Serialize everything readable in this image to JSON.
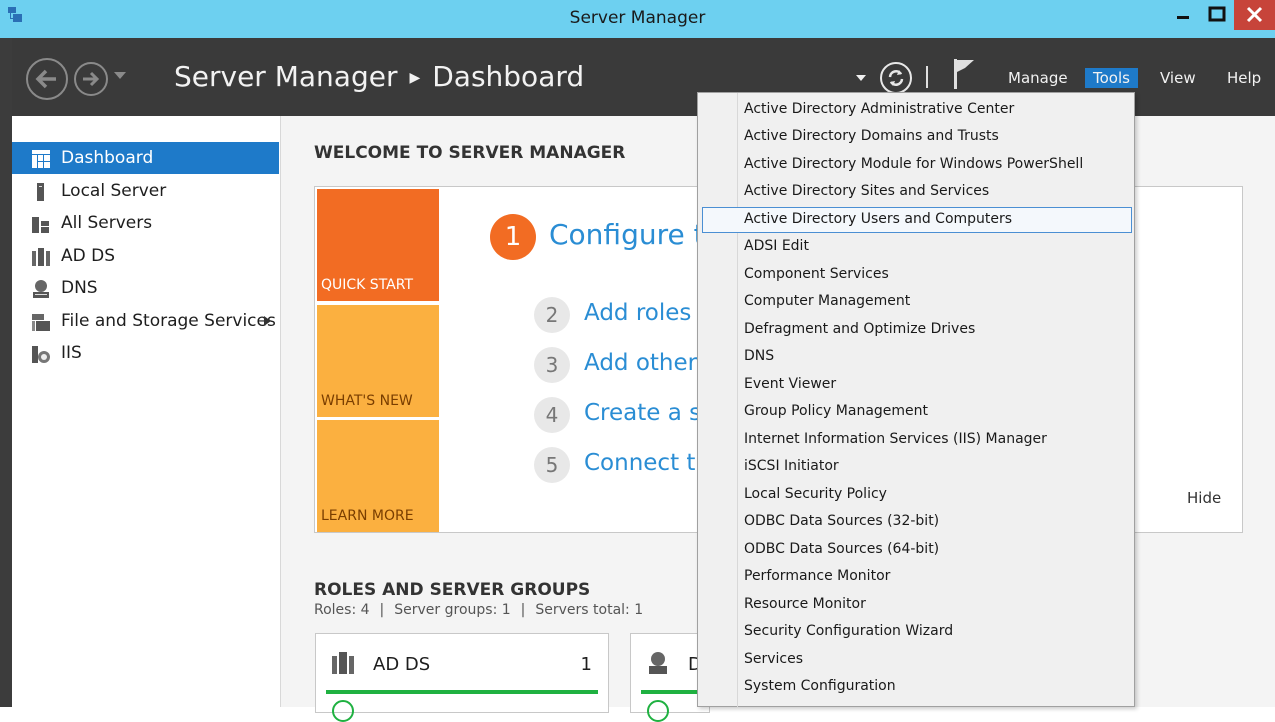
{
  "window": {
    "title": "Server Manager"
  },
  "header": {
    "breadcrumb_root": "Server Manager",
    "breadcrumb_page": "Dashboard",
    "menus": [
      "Manage",
      "Tools",
      "View",
      "Help"
    ],
    "active_menu": "Tools"
  },
  "sidebar": {
    "items": [
      {
        "label": "Dashboard",
        "icon": "dashboard-icon",
        "selected": true
      },
      {
        "label": "Local Server",
        "icon": "server-icon"
      },
      {
        "label": "All Servers",
        "icon": "servers-icon"
      },
      {
        "label": "AD DS",
        "icon": "ad-ds-icon"
      },
      {
        "label": "DNS",
        "icon": "dns-icon"
      },
      {
        "label": "File and Storage Services",
        "icon": "storage-icon",
        "has_submenu": true
      },
      {
        "label": "IIS",
        "icon": "iis-icon"
      }
    ]
  },
  "welcome": {
    "title": "WELCOME TO SERVER MANAGER",
    "tiles": [
      "QUICK START",
      "WHAT'S NEW",
      "LEARN MORE"
    ],
    "steps": [
      {
        "num": "1",
        "text": "Configure th"
      },
      {
        "num": "2",
        "text": "Add roles ar"
      },
      {
        "num": "3",
        "text": "Add other s"
      },
      {
        "num": "4",
        "text": "Create a ser"
      },
      {
        "num": "5",
        "text": "Connect thi"
      }
    ],
    "hide": "Hide"
  },
  "roles": {
    "title": "ROLES AND SERVER GROUPS",
    "roles_count": "Roles: 4",
    "groups_count": "Server groups: 1",
    "servers_total": "Servers total: 1",
    "cards": [
      {
        "name": "AD DS",
        "count": "1",
        "icon": "ad-ds-icon"
      },
      {
        "name": "D",
        "count": "",
        "icon": "dns-icon"
      }
    ]
  },
  "tools_menu": {
    "highlighted": "Active Directory Users and Computers",
    "items": [
      "Active Directory Administrative Center",
      "Active Directory Domains and Trusts",
      "Active Directory Module for Windows PowerShell",
      "Active Directory Sites and Services",
      "Active Directory Users and Computers",
      "ADSI Edit",
      "Component Services",
      "Computer Management",
      "Defragment and Optimize Drives",
      "DNS",
      "Event Viewer",
      "Group Policy Management",
      "Internet Information Services (IIS) Manager",
      "iSCSI Initiator",
      "Local Security Policy",
      "ODBC Data Sources (32-bit)",
      "ODBC Data Sources (64-bit)",
      "Performance Monitor",
      "Resource Monitor",
      "Security Configuration Wizard",
      "Services",
      "System Configuration"
    ]
  },
  "colors": {
    "titlebar": "#6dd0f0",
    "header": "#3a3a3a",
    "accent": "#1e7ac9",
    "quick_start": "#f26c23",
    "tile_orange": "#fbb040",
    "status_green": "#1fb141"
  }
}
